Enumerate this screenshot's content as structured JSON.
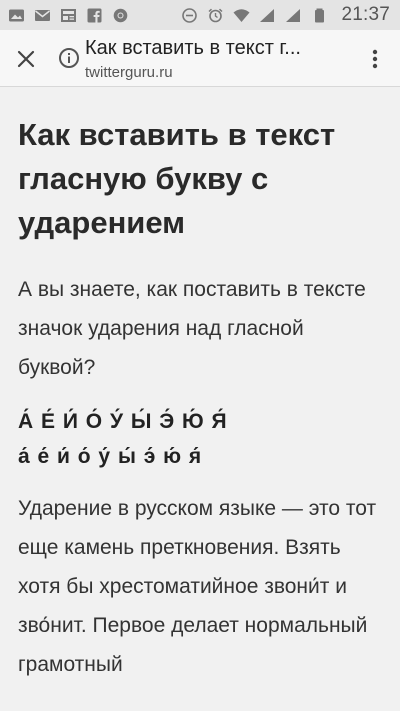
{
  "status_bar": {
    "time": "21:37",
    "left_icons": [
      "gallery-icon",
      "mail-icon",
      "news-icon",
      "facebook-icon",
      "chrome-icon"
    ],
    "right_icons": [
      "minus-circle-icon",
      "alarm-icon",
      "wifi-icon",
      "signal-icon",
      "signal-icon",
      "battery-icon"
    ]
  },
  "toolbar": {
    "title": "Как вставить в текст г...",
    "url": "twitterguru.ru"
  },
  "article": {
    "title": "Как вставить в текст гласную букву с ударением",
    "intro": "А вы знаете, как поставить в тексте значок ударения над гласной буквой?",
    "letters_upper": "А́ Е́ И́ О́ У́ Ы́ Э́ Ю́ Я́",
    "letters_lower": "а́ е́ и́ о́ у́ ы́ э́ ю́ я́",
    "body": "Ударение в русском языке — это тот еще камень преткновения. Взять хотя бы хрестоматийное звони́т и зво́нит. Первое делает нормальный грамотный"
  },
  "colors": {
    "status_bar_bg": "#e4e4e4",
    "toolbar_bg": "#f7f7f7",
    "page_bg": "#f1f1f1",
    "text": "#333333"
  }
}
